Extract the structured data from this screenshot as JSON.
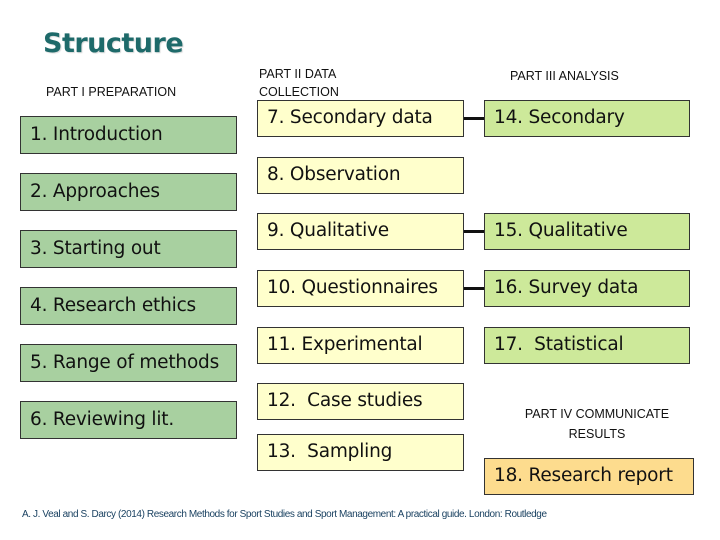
{
  "title": "Structure",
  "parts": {
    "part1": "PART I PREPARATION",
    "part2_line1": "PART II DATA",
    "part2_line2": "COLLECTION",
    "part3": "PART III ANALYSIS",
    "part4_line1": "PART IV  COMMUNICATE",
    "part4_line2": "RESULTS"
  },
  "preparation": [
    "1. Introduction",
    "2. Approaches",
    "3. Starting out",
    "4. Research ethics",
    "5. Range of methods",
    "6. Reviewing lit."
  ],
  "data_collection": [
    "7. Secondary data",
    "8. Observation",
    "9. Qualitative",
    "10. Questionnaires",
    "11. Experimental",
    "12.  Case studies",
    "13.  Sampling"
  ],
  "analysis": [
    "14. Secondary",
    "15. Qualitative",
    "16. Survey data",
    "17.  Statistical"
  ],
  "communicate": [
    "18. Research report"
  ],
  "colors": {
    "title": "#1e6a6a",
    "preparation_fill": "#a8d0a0",
    "data_collection_fill": "#ffffcc",
    "analysis_fill": "#cde99a",
    "communicate_fill": "#fddc8e"
  },
  "citation": "A. J. Veal and S. Darcy (2014) Research Methods for Sport Studies and Sport Management: A practical guide. London: Routledge"
}
